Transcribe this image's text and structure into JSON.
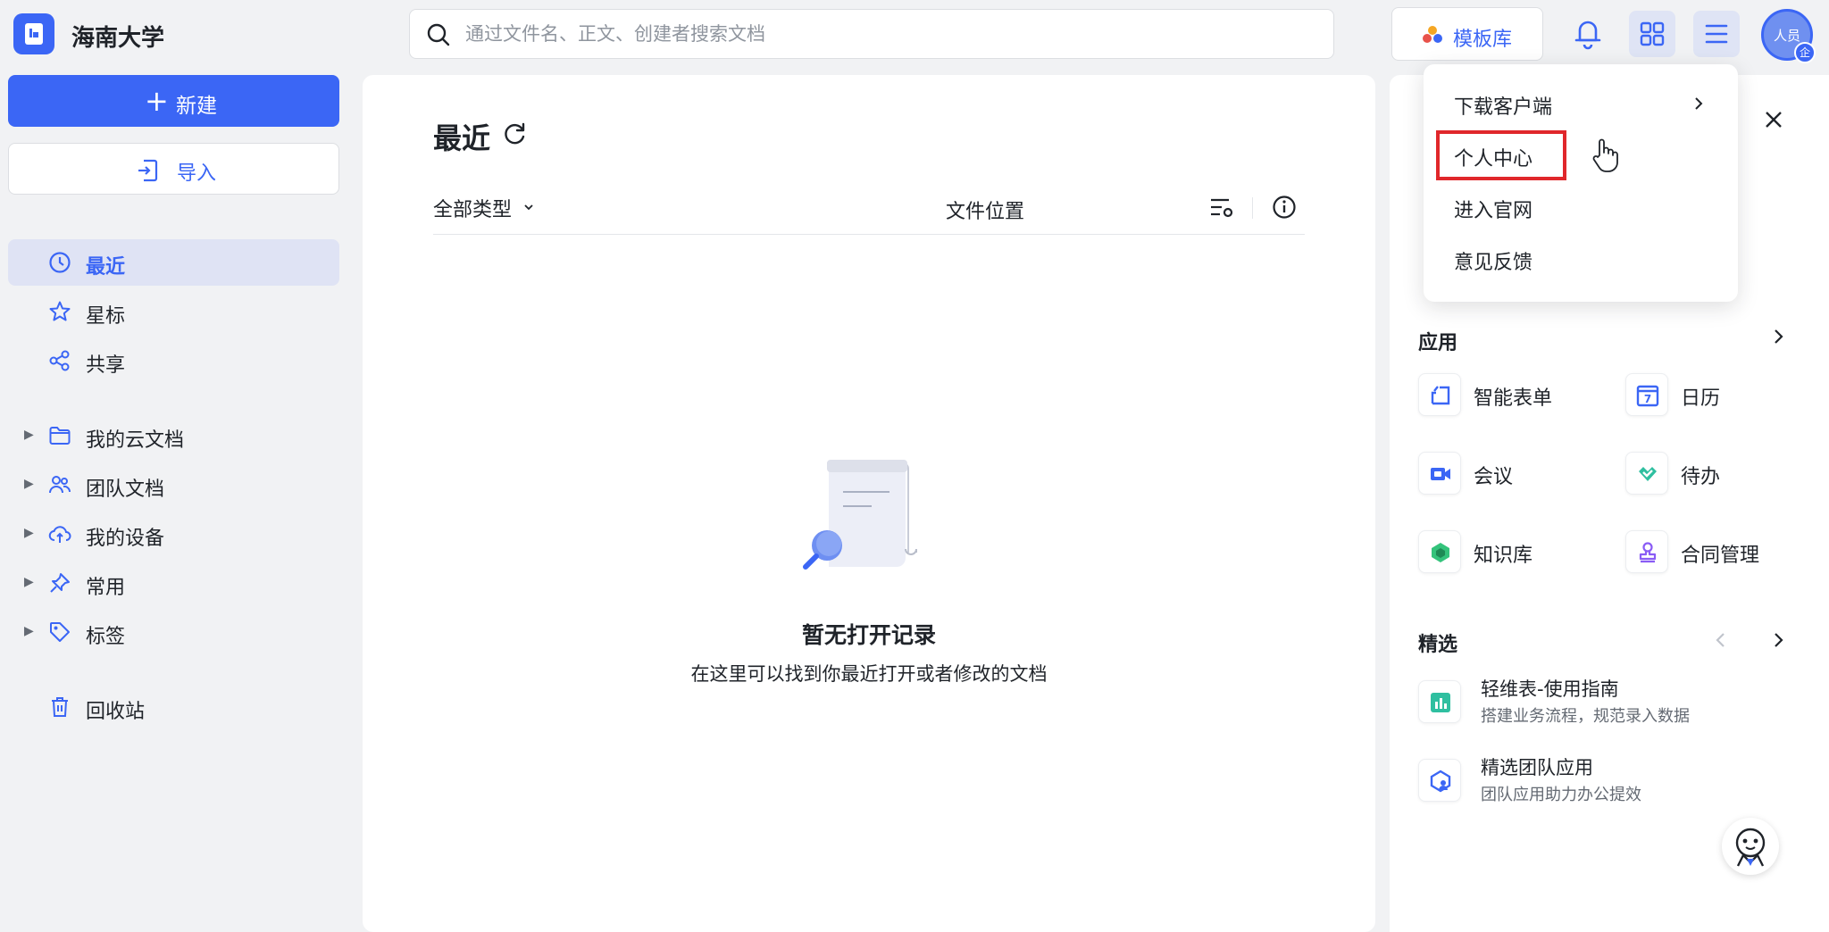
{
  "app": {
    "org_name": "海南大学",
    "search_placeholder": "通过文件名、正文、创建者搜索文档",
    "template_label": "模板库",
    "avatar_text": "人员",
    "avatar_badge": "企",
    "accent_color": "#3b66f5"
  },
  "sidebar": {
    "new_label": "新建",
    "import_label": "导入",
    "items": [
      {
        "label": "最近",
        "icon": "clock-icon",
        "active": true
      },
      {
        "label": "星标",
        "icon": "star-icon"
      },
      {
        "label": "共享",
        "icon": "share-icon"
      },
      {
        "label": "我的云文档",
        "icon": "folder-icon",
        "expandable": true
      },
      {
        "label": "团队文档",
        "icon": "team-icon",
        "expandable": true
      },
      {
        "label": "我的设备",
        "icon": "cloud-upload-icon",
        "expandable": true
      },
      {
        "label": "常用",
        "icon": "pin-icon",
        "expandable": true
      },
      {
        "label": "标签",
        "icon": "tag-icon",
        "expandable": true
      },
      {
        "label": "回收站",
        "icon": "trash-icon"
      }
    ]
  },
  "main": {
    "title": "最近",
    "filter_type": "全部类型",
    "filter_location": "文件位置",
    "empty_title": "暂无打开记录",
    "empty_subtitle": "在这里可以找到你最近打开或者修改的文档"
  },
  "right_panel": {
    "apps_title": "应用",
    "apps": [
      {
        "label": "智能表单",
        "icon": "smart-form-icon"
      },
      {
        "label": "日历",
        "icon": "calendar-icon",
        "icon_text": "7"
      },
      {
        "label": "会议",
        "icon": "meeting-icon"
      },
      {
        "label": "待办",
        "icon": "todo-icon"
      },
      {
        "label": "知识库",
        "icon": "knowledge-base-icon"
      },
      {
        "label": "合同管理",
        "icon": "contract-stamp-icon"
      }
    ],
    "featured_title": "精选",
    "featured": [
      {
        "title": "轻维表-使用指南",
        "subtitle": "搭建业务流程，规范录入数据",
        "icon": "table-chart-icon"
      },
      {
        "title": "精选团队应用",
        "subtitle": "团队应用助力办公提效",
        "icon": "team-app-icon"
      }
    ]
  },
  "dropdown": {
    "items": [
      {
        "label": "下载客户端",
        "has_submenu": true
      },
      {
        "label": "个人中心",
        "highlighted": true
      },
      {
        "label": "进入官网"
      },
      {
        "label": "意见反馈"
      }
    ]
  }
}
